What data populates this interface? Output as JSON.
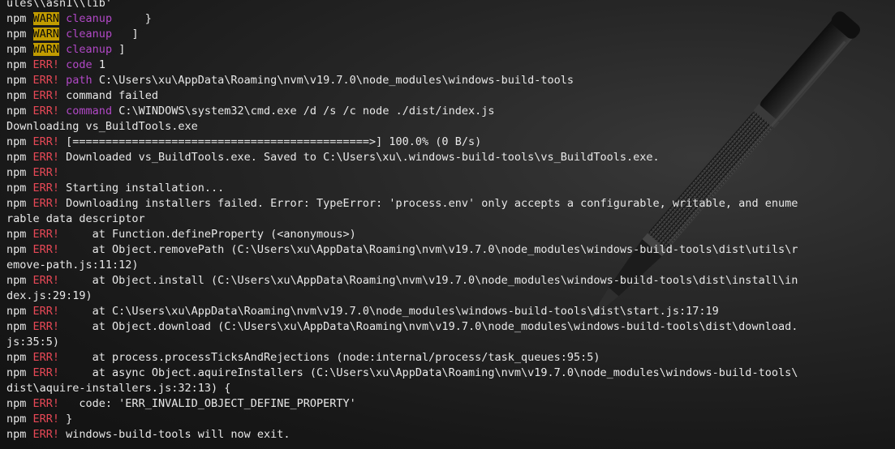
{
  "terminal": {
    "colors": {
      "text": "#e8e8e8",
      "warn_bg": "#c19c00",
      "warn_fg": "#0c0c0c",
      "error": "#e74856",
      "keyword": "#b148c6"
    },
    "background_image": "pen-on-dark-surface",
    "lines": [
      [
        {
          "t": "ules\\\\asn1\\\\lib'",
          "s": ""
        }
      ],
      [
        {
          "t": "npm ",
          "s": ""
        },
        {
          "t": "WARN",
          "s": "warn"
        },
        {
          "t": " ",
          "s": ""
        },
        {
          "t": "cleanup",
          "s": "key"
        },
        {
          "t": "     }",
          "s": ""
        }
      ],
      [
        {
          "t": "npm ",
          "s": ""
        },
        {
          "t": "WARN",
          "s": "warn"
        },
        {
          "t": " ",
          "s": ""
        },
        {
          "t": "cleanup",
          "s": "key"
        },
        {
          "t": "   ]",
          "s": ""
        }
      ],
      [
        {
          "t": "npm ",
          "s": ""
        },
        {
          "t": "WARN",
          "s": "warn"
        },
        {
          "t": " ",
          "s": ""
        },
        {
          "t": "cleanup",
          "s": "key"
        },
        {
          "t": " ]",
          "s": ""
        }
      ],
      [
        {
          "t": "npm ",
          "s": ""
        },
        {
          "t": "ERR!",
          "s": "err"
        },
        {
          "t": " ",
          "s": ""
        },
        {
          "t": "code",
          "s": "key"
        },
        {
          "t": " 1",
          "s": ""
        }
      ],
      [
        {
          "t": "npm ",
          "s": ""
        },
        {
          "t": "ERR!",
          "s": "err"
        },
        {
          "t": " ",
          "s": ""
        },
        {
          "t": "path",
          "s": "key"
        },
        {
          "t": " C:\\Users\\xu\\AppData\\Roaming\\nvm\\v19.7.0\\node_modules\\windows-build-tools",
          "s": ""
        }
      ],
      [
        {
          "t": "npm ",
          "s": ""
        },
        {
          "t": "ERR!",
          "s": "err"
        },
        {
          "t": " command failed",
          "s": ""
        }
      ],
      [
        {
          "t": "npm ",
          "s": ""
        },
        {
          "t": "ERR!",
          "s": "err"
        },
        {
          "t": " ",
          "s": ""
        },
        {
          "t": "command",
          "s": "key"
        },
        {
          "t": " C:\\WINDOWS\\system32\\cmd.exe /d /s /c node ./dist/index.js",
          "s": ""
        }
      ],
      [
        {
          "t": "Downloading vs_BuildTools.exe",
          "s": ""
        }
      ],
      [
        {
          "t": "npm ",
          "s": ""
        },
        {
          "t": "ERR!",
          "s": "err"
        },
        {
          "t": " [=============================================>] 100.0% (0 B/s)",
          "s": ""
        }
      ],
      [
        {
          "t": "npm ",
          "s": ""
        },
        {
          "t": "ERR!",
          "s": "err"
        },
        {
          "t": " Downloaded vs_BuildTools.exe. Saved to C:\\Users\\xu\\.windows-build-tools\\vs_BuildTools.exe.",
          "s": ""
        }
      ],
      [
        {
          "t": "npm ",
          "s": ""
        },
        {
          "t": "ERR!",
          "s": "err"
        }
      ],
      [
        {
          "t": "npm ",
          "s": ""
        },
        {
          "t": "ERR!",
          "s": "err"
        },
        {
          "t": " Starting installation...",
          "s": ""
        }
      ],
      [
        {
          "t": "npm ",
          "s": ""
        },
        {
          "t": "ERR!",
          "s": "err"
        },
        {
          "t": " Downloading installers failed. Error: TypeError: 'process.env' only accepts a configurable, writable, and enume",
          "s": ""
        }
      ],
      [
        {
          "t": "rable data descriptor",
          "s": ""
        }
      ],
      [
        {
          "t": "npm ",
          "s": ""
        },
        {
          "t": "ERR!",
          "s": "err"
        },
        {
          "t": "     at Function.defineProperty (<anonymous>)",
          "s": ""
        }
      ],
      [
        {
          "t": "npm ",
          "s": ""
        },
        {
          "t": "ERR!",
          "s": "err"
        },
        {
          "t": "     at Object.removePath (C:\\Users\\xu\\AppData\\Roaming\\nvm\\v19.7.0\\node_modules\\windows-build-tools\\dist\\utils\\r",
          "s": ""
        }
      ],
      [
        {
          "t": "emove-path.js:11:12)",
          "s": ""
        }
      ],
      [
        {
          "t": "npm ",
          "s": ""
        },
        {
          "t": "ERR!",
          "s": "err"
        },
        {
          "t": "     at Object.install (C:\\Users\\xu\\AppData\\Roaming\\nvm\\v19.7.0\\node_modules\\windows-build-tools\\dist\\install\\in",
          "s": ""
        }
      ],
      [
        {
          "t": "dex.js:29:19)",
          "s": ""
        }
      ],
      [
        {
          "t": "npm ",
          "s": ""
        },
        {
          "t": "ERR!",
          "s": "err"
        },
        {
          "t": "     at C:\\Users\\xu\\AppData\\Roaming\\nvm\\v19.7.0\\node_modules\\windows-build-tools\\dist\\start.js:17:19",
          "s": ""
        }
      ],
      [
        {
          "t": "npm ",
          "s": ""
        },
        {
          "t": "ERR!",
          "s": "err"
        },
        {
          "t": "     at Object.download (C:\\Users\\xu\\AppData\\Roaming\\nvm\\v19.7.0\\node_modules\\windows-build-tools\\dist\\download.",
          "s": ""
        }
      ],
      [
        {
          "t": "js:35:5)",
          "s": ""
        }
      ],
      [
        {
          "t": "npm ",
          "s": ""
        },
        {
          "t": "ERR!",
          "s": "err"
        },
        {
          "t": "     at process.processTicksAndRejections (node:internal/process/task_queues:95:5)",
          "s": ""
        }
      ],
      [
        {
          "t": "npm ",
          "s": ""
        },
        {
          "t": "ERR!",
          "s": "err"
        },
        {
          "t": "     at async Object.aquireInstallers (C:\\Users\\xu\\AppData\\Roaming\\nvm\\v19.7.0\\node_modules\\windows-build-tools\\",
          "s": ""
        }
      ],
      [
        {
          "t": "dist\\aquire-installers.js:32:13) {",
          "s": ""
        }
      ],
      [
        {
          "t": "npm ",
          "s": ""
        },
        {
          "t": "ERR!",
          "s": "err"
        },
        {
          "t": "   code: 'ERR_INVALID_OBJECT_DEFINE_PROPERTY'",
          "s": ""
        }
      ],
      [
        {
          "t": "npm ",
          "s": ""
        },
        {
          "t": "ERR!",
          "s": "err"
        },
        {
          "t": " }",
          "s": ""
        }
      ],
      [
        {
          "t": "npm ",
          "s": ""
        },
        {
          "t": "ERR!",
          "s": "err"
        },
        {
          "t": " windows-build-tools will now exit.",
          "s": ""
        }
      ]
    ]
  }
}
